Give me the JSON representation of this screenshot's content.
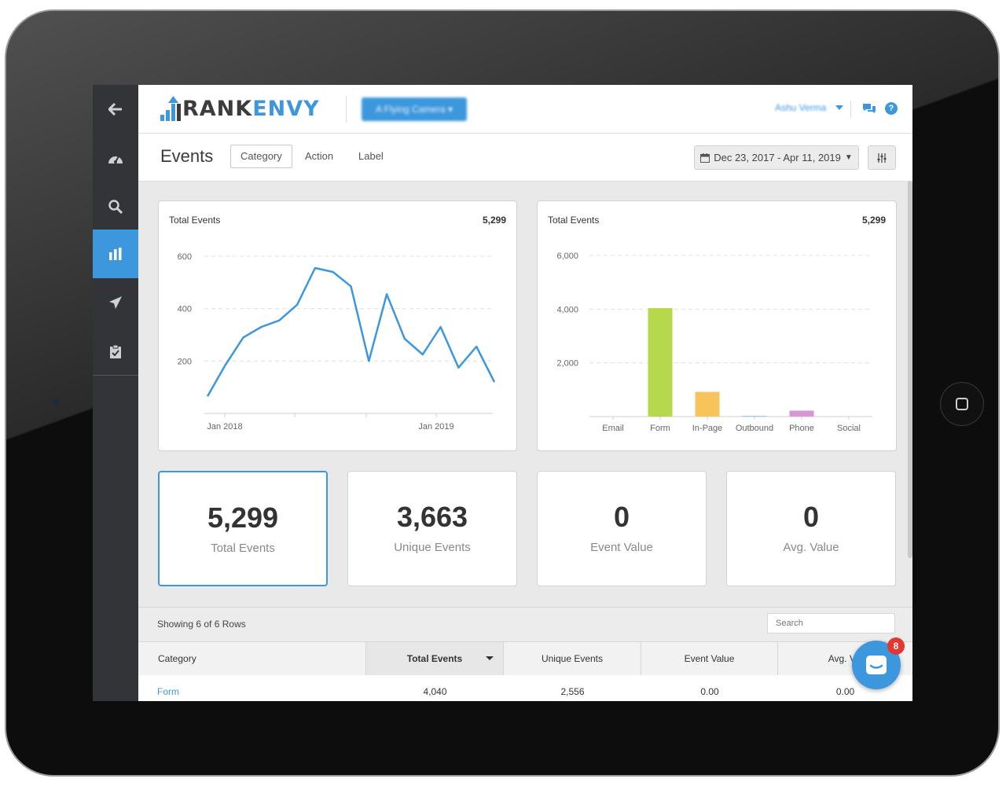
{
  "app": {
    "logo_prefix": "RANK",
    "logo_suffix": "ENVY",
    "account_button": "A Flying Camera",
    "user_name": "Ashu Verma",
    "help_glyph": "?"
  },
  "sidebar": {
    "items": [
      {
        "icon": "arrow-left-icon"
      },
      {
        "icon": "dashboard-icon"
      },
      {
        "icon": "search-icon"
      },
      {
        "icon": "bar-chart-icon",
        "active": true
      },
      {
        "icon": "paper-plane-icon"
      },
      {
        "icon": "clipboard-check-icon"
      }
    ]
  },
  "header": {
    "title": "Events",
    "tabs": [
      "Category",
      "Action",
      "Label"
    ],
    "date_range": "Dec 23, 2017 - Apr 11, 2019"
  },
  "chart_data": [
    {
      "type": "line",
      "title": "Total Events",
      "total": "5,299",
      "x_tick_labels": [
        "Jan 2018",
        "Jan 2019"
      ],
      "y_ticks": [
        "200",
        "400",
        "600"
      ],
      "ylim": [
        0,
        600
      ],
      "grid": true,
      "series": [
        {
          "color": "#3d97dd",
          "values": [
            65,
            185,
            290,
            330,
            355,
            415,
            555,
            540,
            485,
            200,
            455,
            285,
            225,
            330,
            175,
            255,
            120
          ]
        }
      ]
    },
    {
      "type": "bar",
      "title": "Total Events",
      "total": "5,299",
      "categories": [
        "Email",
        "Form",
        "In-Page",
        "Outbound",
        "Phone",
        "Social"
      ],
      "values": [
        0,
        4040,
        920,
        30,
        220,
        0
      ],
      "colors": [
        "#3d97dd",
        "#b5d84d",
        "#f7c35b",
        "#9cc9ec",
        "#d796d4",
        "#cccccc"
      ],
      "y_ticks": [
        "2,000",
        "4,000",
        "6,000"
      ],
      "ylim": [
        0,
        6000
      ],
      "grid": true
    }
  ],
  "stats": [
    {
      "value": "5,299",
      "label": "Total Events",
      "active": true
    },
    {
      "value": "3,663",
      "label": "Unique Events"
    },
    {
      "value": "0",
      "label": "Event Value"
    },
    {
      "value": "0",
      "label": "Avg. Value"
    }
  ],
  "table": {
    "rows_text": "Showing 6 of 6 Rows",
    "search_placeholder": "Search",
    "columns": [
      "Category",
      "Total Events",
      "Unique Events",
      "Event Value",
      "Avg. Val"
    ],
    "rows": [
      [
        "Form",
        "4,040",
        "2,556",
        "0.00",
        "0.00"
      ]
    ]
  },
  "chat": {
    "badge": "8"
  },
  "colors": {
    "accent": "#3d97dd",
    "sidebar": "#333437"
  }
}
